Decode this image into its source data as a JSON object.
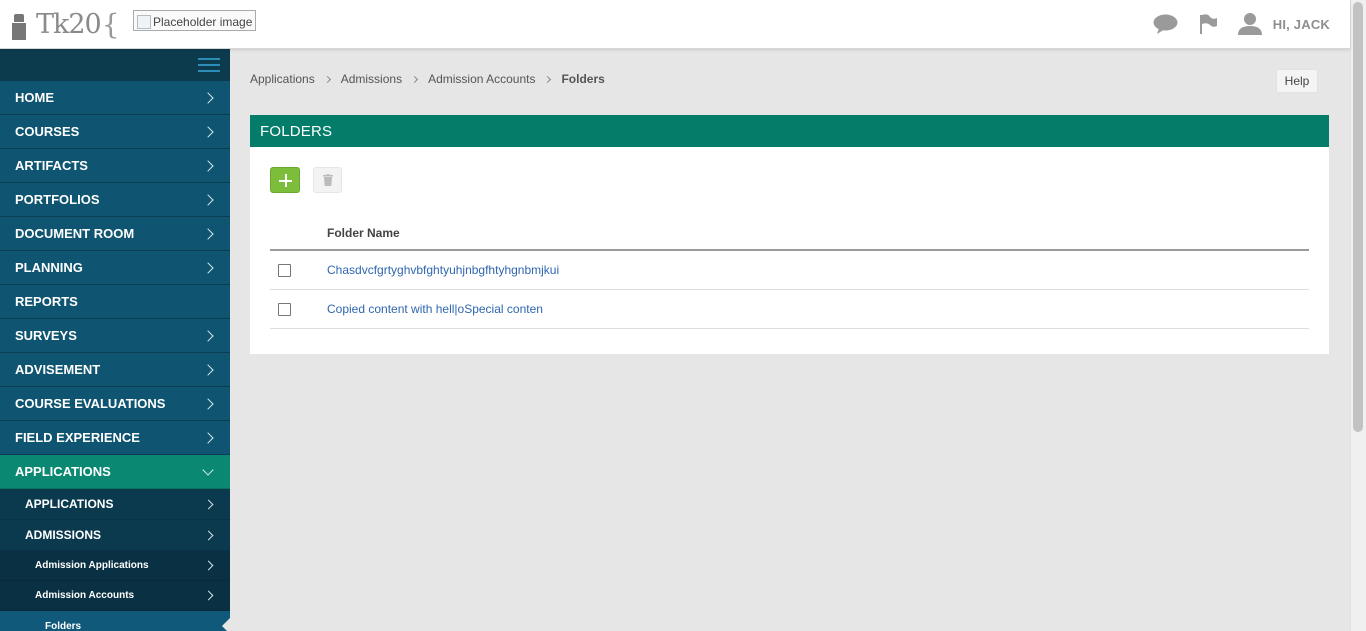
{
  "header": {
    "logo_text": "Tk20",
    "logo_brace": "{",
    "placeholder_image_text": "Placeholder image",
    "user_greeting": "HI, JACK",
    "icons": [
      "chat-bubble-icon",
      "flag-icon",
      "user-icon"
    ]
  },
  "sidebar": {
    "menu_icon": "hamburger-icon",
    "items": [
      {
        "label": "HOME"
      },
      {
        "label": "COURSES"
      },
      {
        "label": "ARTIFACTS"
      },
      {
        "label": "PORTFOLIOS"
      },
      {
        "label": "DOCUMENT ROOM"
      },
      {
        "label": "PLANNING"
      },
      {
        "label": "REPORTS"
      },
      {
        "label": "SURVEYS"
      },
      {
        "label": "ADVISEMENT"
      },
      {
        "label": "COURSE EVALUATIONS"
      },
      {
        "label": "FIELD EXPERIENCE"
      },
      {
        "label": "APPLICATIONS"
      }
    ],
    "sub_items": [
      {
        "label": "APPLICATIONS"
      },
      {
        "label": "ADMISSIONS"
      }
    ],
    "sub2_items": [
      {
        "label": "Admission Applications"
      },
      {
        "label": "Admission Accounts"
      }
    ],
    "sub3_items": [
      {
        "label": "Folders"
      }
    ]
  },
  "breadcrumb": [
    "Applications",
    "Admissions",
    "Admission Accounts",
    "Folders"
  ],
  "help_label": "Help",
  "panel": {
    "title": "FOLDERS",
    "column_header": "Folder Name",
    "rows": [
      {
        "name": "Chasdvcfgrtyghvbfghtyuhjnbgfhtyhgnbmjkui"
      },
      {
        "name": "Copied content with hell|oSpecial conten"
      }
    ]
  },
  "colors": {
    "sidebar_bg": "#0f5470",
    "sidebar_active": "#0a8872",
    "panel_header": "#037c69",
    "add_button": "#7cbd3c",
    "link": "#2f66b0"
  }
}
